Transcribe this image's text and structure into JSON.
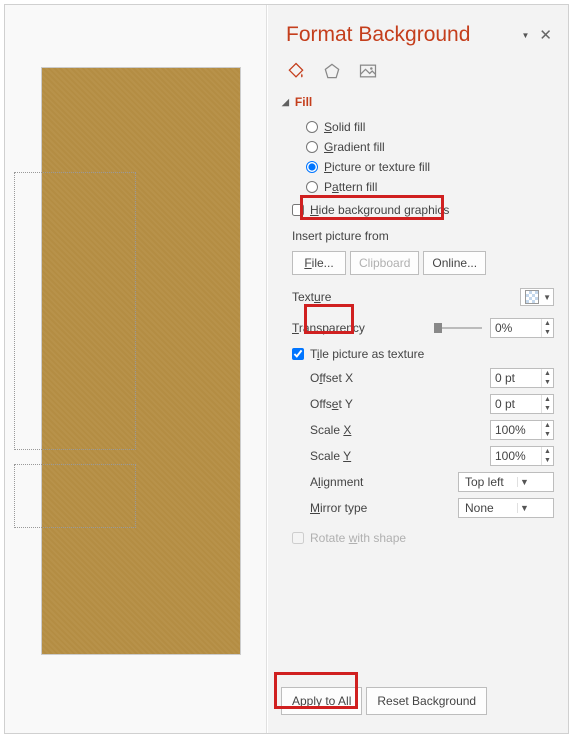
{
  "panel": {
    "title": "Format Background",
    "section": {
      "label": "Fill"
    },
    "fill_options": {
      "solid": "Solid fill",
      "gradient": "Gradient fill",
      "picture": "Picture or texture fill",
      "pattern": "Pattern fill",
      "selected": "picture"
    },
    "hide_bg": {
      "label": "Hide background graphics",
      "checked": false
    },
    "insert_from": {
      "label": "Insert picture from",
      "file_btn": "File...",
      "clipboard_btn": "Clipboard",
      "online_btn": "Online..."
    },
    "texture": {
      "label": "Texture"
    },
    "transparency": {
      "label": "Transparency",
      "value": "0%"
    },
    "tile": {
      "label": "Tile picture as texture",
      "checked": true
    },
    "offset_x": {
      "label": "Offset X",
      "value": "0 pt"
    },
    "offset_y": {
      "label": "Offset Y",
      "value": "0 pt"
    },
    "scale_x": {
      "label": "Scale X",
      "value": "100%"
    },
    "scale_y": {
      "label": "Scale Y",
      "value": "100%"
    },
    "alignment": {
      "label": "Alignment",
      "value": "Top left"
    },
    "mirror": {
      "label": "Mirror type",
      "value": "None"
    },
    "rotate": {
      "label": "Rotate with shape",
      "checked": false
    },
    "footer": {
      "apply_all": "Apply to All",
      "reset": "Reset Background"
    }
  }
}
